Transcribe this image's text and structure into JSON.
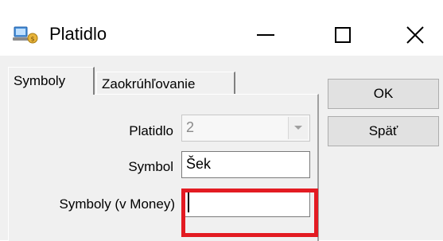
{
  "window": {
    "title": "Platidlo",
    "icon": "money-app-icon",
    "controls": {
      "minimize": "minimize-icon",
      "maximize": "maximize-icon",
      "close": "close-icon"
    }
  },
  "tabs": [
    {
      "label": "Symboly",
      "active": true
    },
    {
      "label": "Zaokrúhľovanie",
      "active": false
    }
  ],
  "form": {
    "platidlo": {
      "label": "Platidlo",
      "value": "2",
      "disabled": true
    },
    "symbol": {
      "label": "Symbol",
      "value": "Šek"
    },
    "symboly_money": {
      "label": "Symboly (v Money)",
      "value": ""
    }
  },
  "buttons": {
    "ok": "OK",
    "back": "Späť"
  },
  "highlight_color": "#e31b22"
}
